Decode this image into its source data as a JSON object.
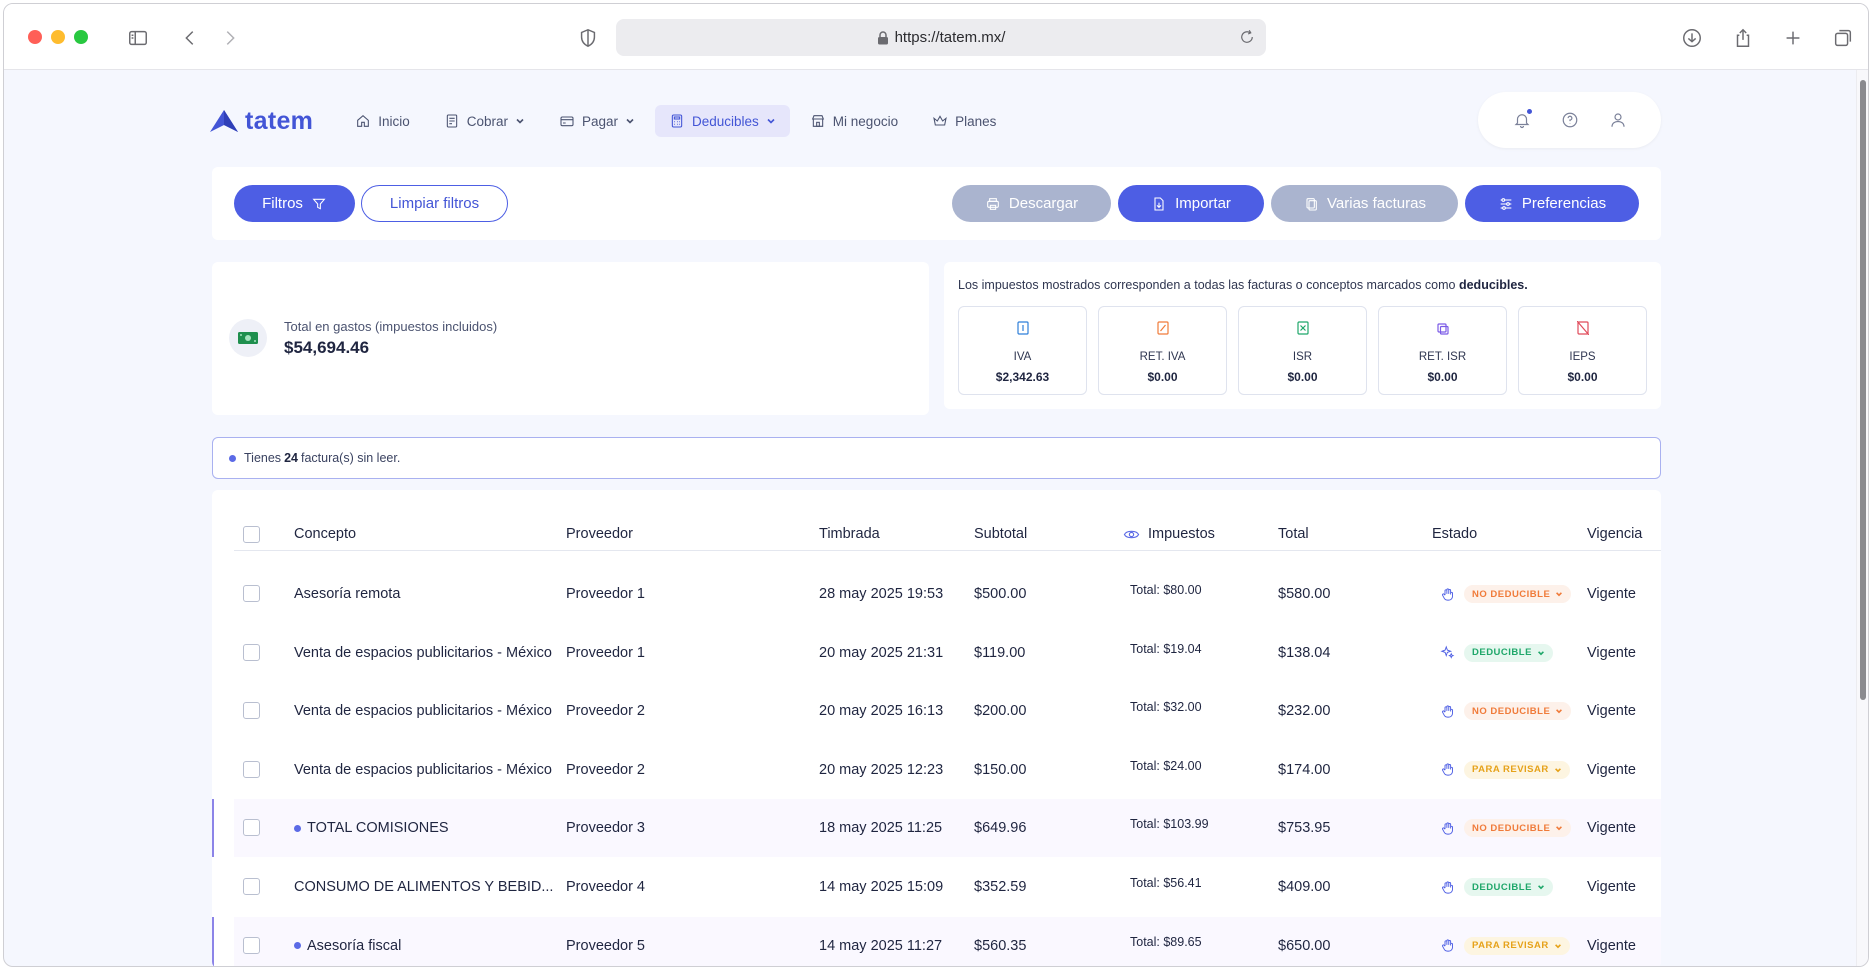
{
  "browser": {
    "url": "https://tatem.mx/"
  },
  "nav": {
    "brand": "tatem",
    "items": [
      {
        "label": "Inicio",
        "icon": "home-icon"
      },
      {
        "label": "Cobrar",
        "icon": "invoice-icon"
      },
      {
        "label": "Pagar",
        "icon": "card-icon"
      },
      {
        "label": "Deducibles",
        "icon": "calculator-icon",
        "active": true
      },
      {
        "label": "Mi negocio",
        "icon": "store-icon"
      },
      {
        "label": "Planes",
        "icon": "crown-icon"
      }
    ]
  },
  "toolbar": {
    "filters": "Filtros",
    "clear_filters": "Limpiar filtros",
    "download": "Descargar",
    "import": "Importar",
    "multiple_invoices": "Varias facturas",
    "preferences": "Preferencias"
  },
  "summary": {
    "total_label": "Total en gastos (impuestos incluidos)",
    "total_value": "$54,694.46"
  },
  "taxes": {
    "note_prefix": "Los impuestos mostrados corresponden a todas las facturas o conceptos marcados como",
    "note_bold": "deducibles.",
    "items": [
      {
        "name": "IVA",
        "value": "$2,342.63",
        "color": "#2f7fd9"
      },
      {
        "name": "RET. IVA",
        "value": "$0.00",
        "color": "#f07b3a"
      },
      {
        "name": "ISR",
        "value": "$0.00",
        "color": "#1fa76a"
      },
      {
        "name": "RET. ISR",
        "value": "$0.00",
        "color": "#7b5be6"
      },
      {
        "name": "IEPS",
        "value": "$0.00",
        "color": "#e04a5a"
      }
    ]
  },
  "unread": {
    "prefix": "Tienes",
    "count": "24",
    "suffix": "factura(s) sin leer."
  },
  "table": {
    "headers": {
      "concept": "Concepto",
      "provider": "Proveedor",
      "stamped": "Timbrada",
      "subtotal": "Subtotal",
      "taxes": "Impuestos",
      "total": "Total",
      "status": "Estado",
      "validity": "Vigencia"
    },
    "rows": [
      {
        "concept": "Asesoría remota",
        "provider": "Proveedor 1",
        "stamped": "28 may 2025 19:53",
        "subtotal": "$500.00",
        "taxes": "Total: $80.00",
        "total": "$580.00",
        "status": "NO DEDUCIBLE",
        "status_kind": "no",
        "status_icon": "hand-icon",
        "validity": "Vigente",
        "unread": false
      },
      {
        "concept": "Venta de espacios publicitarios - México",
        "provider": "Proveedor 1",
        "stamped": "20 may 2025 21:31",
        "subtotal": "$119.00",
        "taxes": "Total: $19.04",
        "total": "$138.04",
        "status": "DEDUCIBLE",
        "status_kind": "si",
        "status_icon": "sparkle-icon",
        "validity": "Vigente",
        "unread": false
      },
      {
        "concept": "Venta de espacios publicitarios - México",
        "provider": "Proveedor 2",
        "stamped": "20 may 2025 16:13",
        "subtotal": "$200.00",
        "taxes": "Total: $32.00",
        "total": "$232.00",
        "status": "NO DEDUCIBLE",
        "status_kind": "no",
        "status_icon": "hand-icon",
        "validity": "Vigente",
        "unread": false
      },
      {
        "concept": "Venta de espacios publicitarios - México",
        "provider": "Proveedor 2",
        "stamped": "20 may 2025 12:23",
        "subtotal": "$150.00",
        "taxes": "Total: $24.00",
        "total": "$174.00",
        "status": "PARA REVISAR",
        "status_kind": "rev",
        "status_icon": "hand-icon",
        "validity": "Vigente",
        "unread": false
      },
      {
        "concept": "TOTAL COMISIONES",
        "provider": "Proveedor 3",
        "stamped": "18 may 2025 11:25",
        "subtotal": "$649.96",
        "taxes": "Total: $103.99",
        "total": "$753.95",
        "status": "NO DEDUCIBLE",
        "status_kind": "no",
        "status_icon": "hand-icon",
        "validity": "Vigente",
        "unread": true
      },
      {
        "concept": "CONSUMO DE ALIMENTOS Y BEBID...",
        "provider": "Proveedor 4",
        "stamped": "14 may 2025 15:09",
        "subtotal": "$352.59",
        "taxes": "Total: $56.41",
        "total": "$409.00",
        "status": "DEDUCIBLE",
        "status_kind": "si",
        "status_icon": "hand-icon",
        "validity": "Vigente",
        "unread": false
      },
      {
        "concept": "Asesoría fiscal",
        "provider": "Proveedor 5",
        "stamped": "14 may 2025 11:27",
        "subtotal": "$560.35",
        "taxes": "Total: $89.65",
        "total": "$650.00",
        "status": "PARA REVISAR",
        "status_kind": "rev",
        "status_icon": "hand-icon",
        "validity": "Vigente",
        "unread": true
      }
    ]
  }
}
